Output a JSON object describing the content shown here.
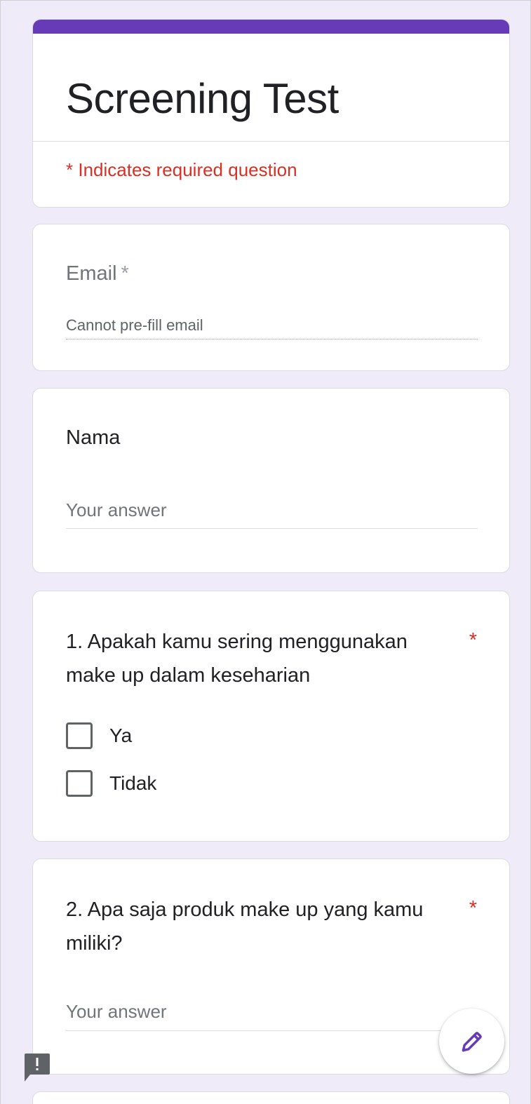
{
  "form": {
    "title": "Screening Test",
    "required_note": "* Indicates required question",
    "accent_color": "#673ab7"
  },
  "email": {
    "label": "Email",
    "required_mark": "*",
    "hint": "Cannot pre-fill email"
  },
  "name_question": {
    "label": "Nama",
    "placeholder": "Your answer"
  },
  "question1": {
    "label": "1. Apakah kamu sering menggunakan make up dalam keseharian",
    "required_mark": "*",
    "options": [
      {
        "label": "Ya",
        "checked": false
      },
      {
        "label": "Tidak",
        "checked": false
      }
    ]
  },
  "question2": {
    "label": "2. Apa saja produk make up yang kamu miliki?",
    "required_mark": "*",
    "placeholder": "Your answer"
  },
  "icons": {
    "fab": "pencil-icon",
    "feedback": "feedback-icon"
  }
}
